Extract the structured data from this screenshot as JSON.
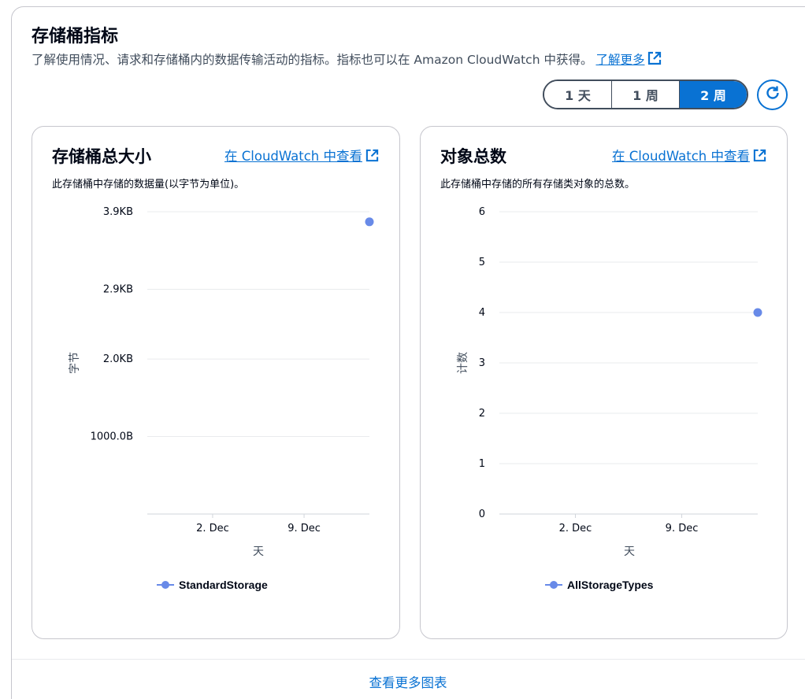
{
  "header": {
    "title": "存储桶指标",
    "description": "了解使用情况、请求和存储桶内的数据传输活动的指标。指标也可以在 Amazon CloudWatch 中获得。",
    "learn_more": "了解更多"
  },
  "range": {
    "options": [
      "1 天",
      "1 周",
      "2 周"
    ],
    "selected": "2 周"
  },
  "refresh_icon": "refresh-icon",
  "cards": [
    {
      "title": "存储桶总大小",
      "link": "在 CloudWatch 中查看",
      "description": "此存储桶中存储的数据量(以字节为单位)。",
      "ylabel": "字节",
      "xlabel": "天",
      "legend": "StandardStorage"
    },
    {
      "title": "对象总数",
      "link": "在 CloudWatch 中查看",
      "description": "此存储桶中存储的所有存储类对象的总数。",
      "ylabel": "计数",
      "xlabel": "天",
      "legend": "AllStorageTypes"
    }
  ],
  "footer": {
    "more_charts": "查看更多图表"
  },
  "colors": {
    "accent": "#0972d3",
    "series": "#688ae8",
    "grid": "#e9ebed"
  },
  "chart_data": [
    {
      "type": "scatter",
      "title": "存储桶总大小",
      "xlabel": "天",
      "ylabel": "字节",
      "x_ticks": [
        "2. Dec",
        "9. Dec"
      ],
      "y_ticks": [
        {
          "label": "1000.0B",
          "value": 1000
        },
        {
          "label": "2.0KB",
          "value": 2000
        },
        {
          "label": "2.9KB",
          "value": 2900
        },
        {
          "label": "3.9KB",
          "value": 3900
        }
      ],
      "ylim": [
        0,
        3900
      ],
      "xlim": [
        "Nov 27",
        "Dec 14"
      ],
      "series": [
        {
          "name": "StandardStorage",
          "points": [
            {
              "x": "Dec 14",
              "y": 3770
            }
          ]
        }
      ],
      "grid": true,
      "legend": "bottom"
    },
    {
      "type": "scatter",
      "title": "对象总数",
      "xlabel": "天",
      "ylabel": "计数",
      "x_ticks": [
        "2. Dec",
        "9. Dec"
      ],
      "y_ticks": [
        {
          "label": "0",
          "value": 0
        },
        {
          "label": "1",
          "value": 1
        },
        {
          "label": "2",
          "value": 2
        },
        {
          "label": "3",
          "value": 3
        },
        {
          "label": "4",
          "value": 4
        },
        {
          "label": "5",
          "value": 5
        },
        {
          "label": "6",
          "value": 6
        }
      ],
      "ylim": [
        0,
        6
      ],
      "xlim": [
        "Nov 27",
        "Dec 14"
      ],
      "series": [
        {
          "name": "AllStorageTypes",
          "points": [
            {
              "x": "Dec 14",
              "y": 4
            }
          ]
        }
      ],
      "grid": true,
      "legend": "bottom"
    }
  ]
}
